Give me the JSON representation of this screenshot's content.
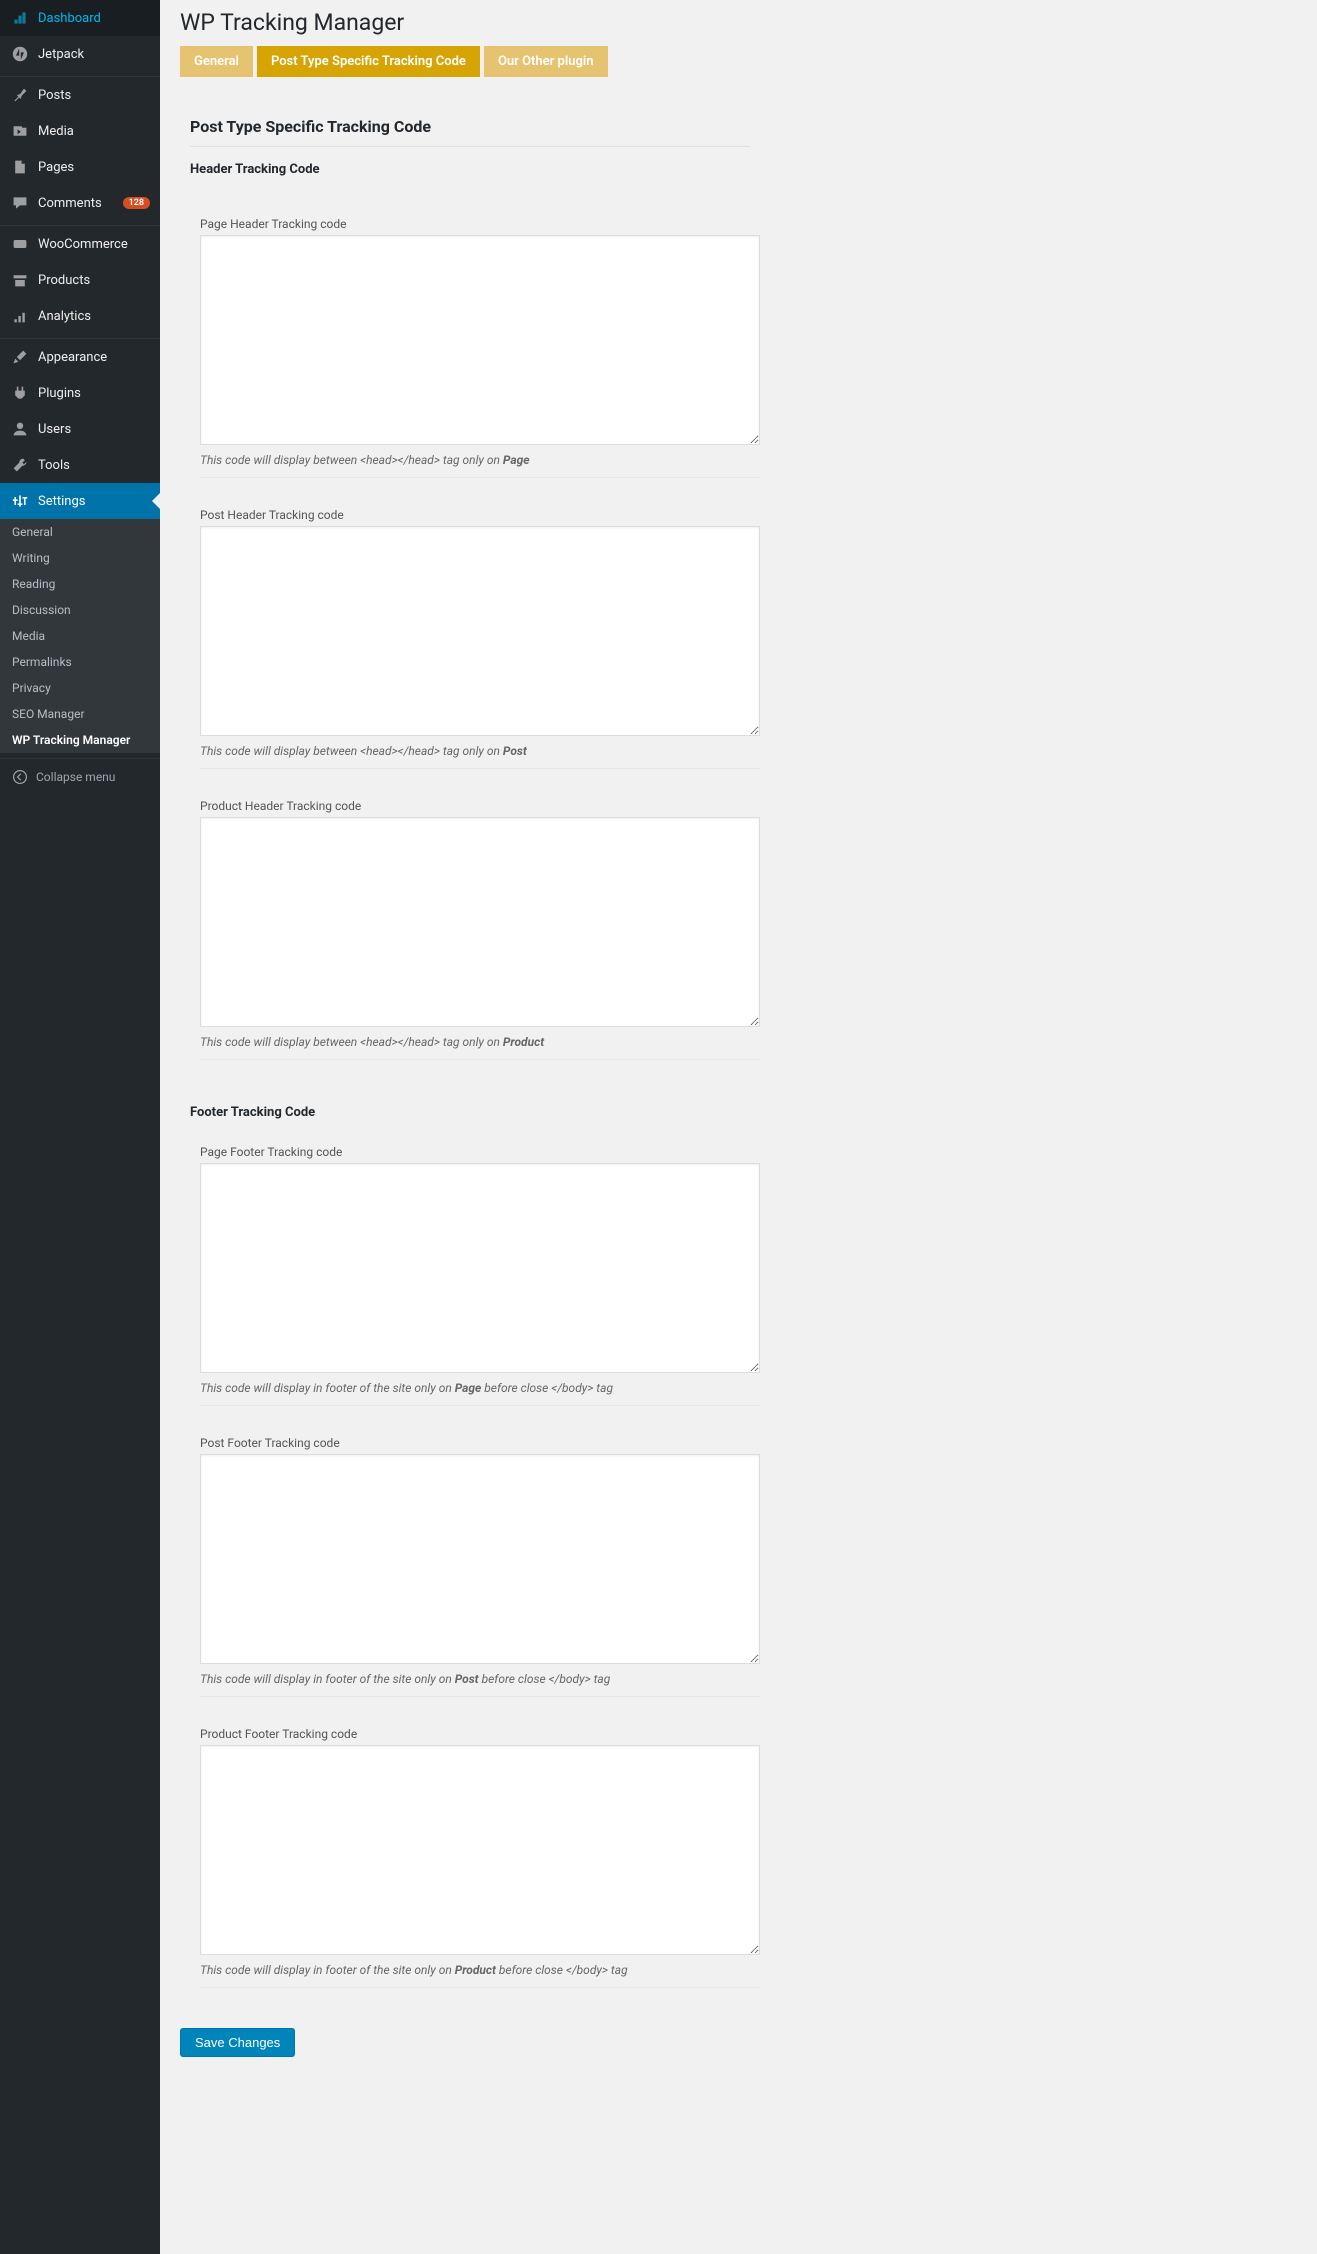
{
  "sidebar": {
    "items": [
      {
        "label": "Dashboard",
        "icon": "dashboard"
      },
      {
        "label": "Jetpack",
        "icon": "jetpack"
      },
      {
        "label": "Posts",
        "icon": "pin"
      },
      {
        "label": "Media",
        "icon": "media"
      },
      {
        "label": "Pages",
        "icon": "page"
      },
      {
        "label": "Comments",
        "icon": "comment",
        "badge": "128"
      },
      {
        "label": "WooCommerce",
        "icon": "woo"
      },
      {
        "label": "Products",
        "icon": "product"
      },
      {
        "label": "Analytics",
        "icon": "analytics"
      },
      {
        "label": "Appearance",
        "icon": "brush"
      },
      {
        "label": "Plugins",
        "icon": "plugin"
      },
      {
        "label": "Users",
        "icon": "user"
      },
      {
        "label": "Tools",
        "icon": "tool"
      },
      {
        "label": "Settings",
        "icon": "settings"
      }
    ],
    "subitems": [
      {
        "label": "General"
      },
      {
        "label": "Writing"
      },
      {
        "label": "Reading"
      },
      {
        "label": "Discussion"
      },
      {
        "label": "Media"
      },
      {
        "label": "Permalinks"
      },
      {
        "label": "Privacy"
      },
      {
        "label": "SEO Manager"
      },
      {
        "label": "WP Tracking Manager",
        "current": true
      }
    ],
    "collapse_label": "Collapse menu"
  },
  "header": {
    "title": "WP Tracking Manager"
  },
  "tabs": [
    {
      "label": "General"
    },
    {
      "label": "Post Type Specific Tracking Code",
      "active": true
    },
    {
      "label": "Our Other plugin"
    }
  ],
  "section": {
    "title": "Post Type Specific Tracking Code",
    "header_heading": "Header Tracking Code",
    "footer_heading": "Footer Tracking Code",
    "fields": {
      "page_header": {
        "label": "Page Header Tracking code",
        "desc_prefix": "This code will display between <head></head> tag only on ",
        "desc_strong": "Page",
        "desc_suffix": ""
      },
      "post_header": {
        "label": "Post Header Tracking code",
        "desc_prefix": "This code will display between <head></head> tag only on ",
        "desc_strong": "Post",
        "desc_suffix": ""
      },
      "product_header": {
        "label": "Product Header Tracking code",
        "desc_prefix": "This code will display between <head></head> tag only on ",
        "desc_strong": "Product",
        "desc_suffix": ""
      },
      "page_footer": {
        "label": "Page Footer Tracking code",
        "desc_prefix": "This code will display in footer of the site only on ",
        "desc_strong": "Page",
        "desc_suffix": " before close </body> tag"
      },
      "post_footer": {
        "label": "Post Footer Tracking code",
        "desc_prefix": "This code will display in footer of the site only on ",
        "desc_strong": "Post",
        "desc_suffix": " before close </body> tag"
      },
      "product_footer": {
        "label": "Product Footer Tracking code",
        "desc_prefix": "This code will display in footer of the site only on ",
        "desc_strong": "Product",
        "desc_suffix": " before close </body> tag"
      }
    },
    "save_label": "Save Changes"
  }
}
